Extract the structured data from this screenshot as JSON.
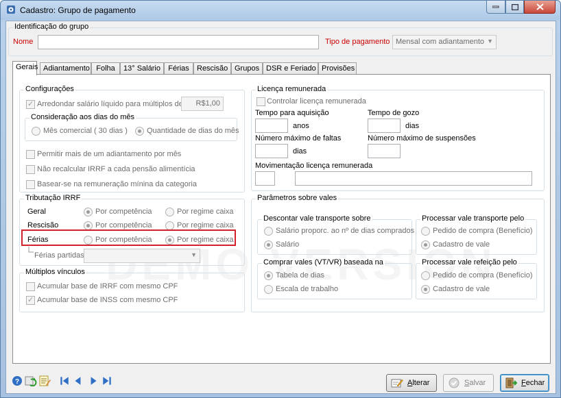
{
  "window": {
    "title": "Cadastro: Grupo de pagamento"
  },
  "identificacao": {
    "group_title": "Identificação do grupo",
    "nome_label": "Nome",
    "nome_value": "",
    "tipo_label": "Tipo de pagamento",
    "tipo_value": "Mensal com adiantamento"
  },
  "tabs": [
    {
      "label": "Gerais"
    },
    {
      "label": "Adiantamento"
    },
    {
      "label": "Folha"
    },
    {
      "label": "13° Salário"
    },
    {
      "label": "Férias"
    },
    {
      "label": "Rescisão"
    },
    {
      "label": "Grupos"
    },
    {
      "label": "DSR e Feriado"
    },
    {
      "label": "Provisões"
    }
  ],
  "configuracoes": {
    "title": "Configurações",
    "arredondar_label": "Arredondar salário líquido para múltiplos de",
    "arredondar_value": "R$1,00",
    "consideracao_title": "Consideração aos dias do mês",
    "mes_comercial": "Mês comercial ( 30 dias )",
    "quantidade_dias": "Quantidade de dias do mês",
    "permitir": "Permitir mais de um adiantamento por mês",
    "nao_recalcular": "Não recalcular IRRF a cada pensão alimentícia",
    "basear": "Basear-se na remuneração mínina da categoria"
  },
  "tributacao": {
    "title": "Tributação IRRF",
    "rows": [
      {
        "label": "Geral",
        "opt1": "Por competência",
        "opt2": "Por regime caixa",
        "selected": 1
      },
      {
        "label": "Rescisão",
        "opt1": "Por competência",
        "opt2": "Por regime caixa",
        "selected": 1
      },
      {
        "label": "Férias",
        "opt1": "Por competência",
        "opt2": "Por regime caixa",
        "selected": 2
      }
    ],
    "ferias_partidas": "Férias partidas"
  },
  "multiplos": {
    "title": "Múltiplos vínculos",
    "irrf": "Acumular base de IRRF com mesmo CPF",
    "inss": "Acumular base de INSS com mesmo CPF"
  },
  "licenca": {
    "title": "Licença remunerada",
    "controlar": "Controlar licença remunerada",
    "tempo_aquisicao": "Tempo para aquisição",
    "anos": "anos",
    "tempo_gozo": "Tempo de gozo",
    "dias": "dias",
    "max_faltas": "Número máximo de faltas",
    "max_suspensoes": "Número máximo de suspensões",
    "movimentacao": "Movimentação licença remunerada"
  },
  "vales": {
    "title": "Parâmetros sobre vales",
    "descontar_title": "Descontar vale transporte sobre",
    "descontar_opt1": "Salário proporc. ao nº de dias comprados",
    "descontar_opt2": "Salário",
    "processar_vt_title": "Processar vale transporte pelo",
    "processar_vt_opt1": "Pedido de compra (Benefício)",
    "processar_vt_opt2": "Cadastro de vale",
    "comprar_title": "Comprar vales (VT/VR) baseada na",
    "comprar_opt1": "Tabela de dias",
    "comprar_opt2": "Escala de trabalho",
    "processar_vr_title": "Processar vale refeição pelo",
    "processar_vr_opt1": "Pedido de compra (Benefício)",
    "processar_vr_opt2": "Cadastro de vale"
  },
  "watermark": "DEMO VERSION",
  "buttons": {
    "alterar_first": "A",
    "alterar_rest": "lterar",
    "salvar_first": "S",
    "salvar_rest": "alvar",
    "fechar_first": "F",
    "fechar_rest": "echar"
  }
}
